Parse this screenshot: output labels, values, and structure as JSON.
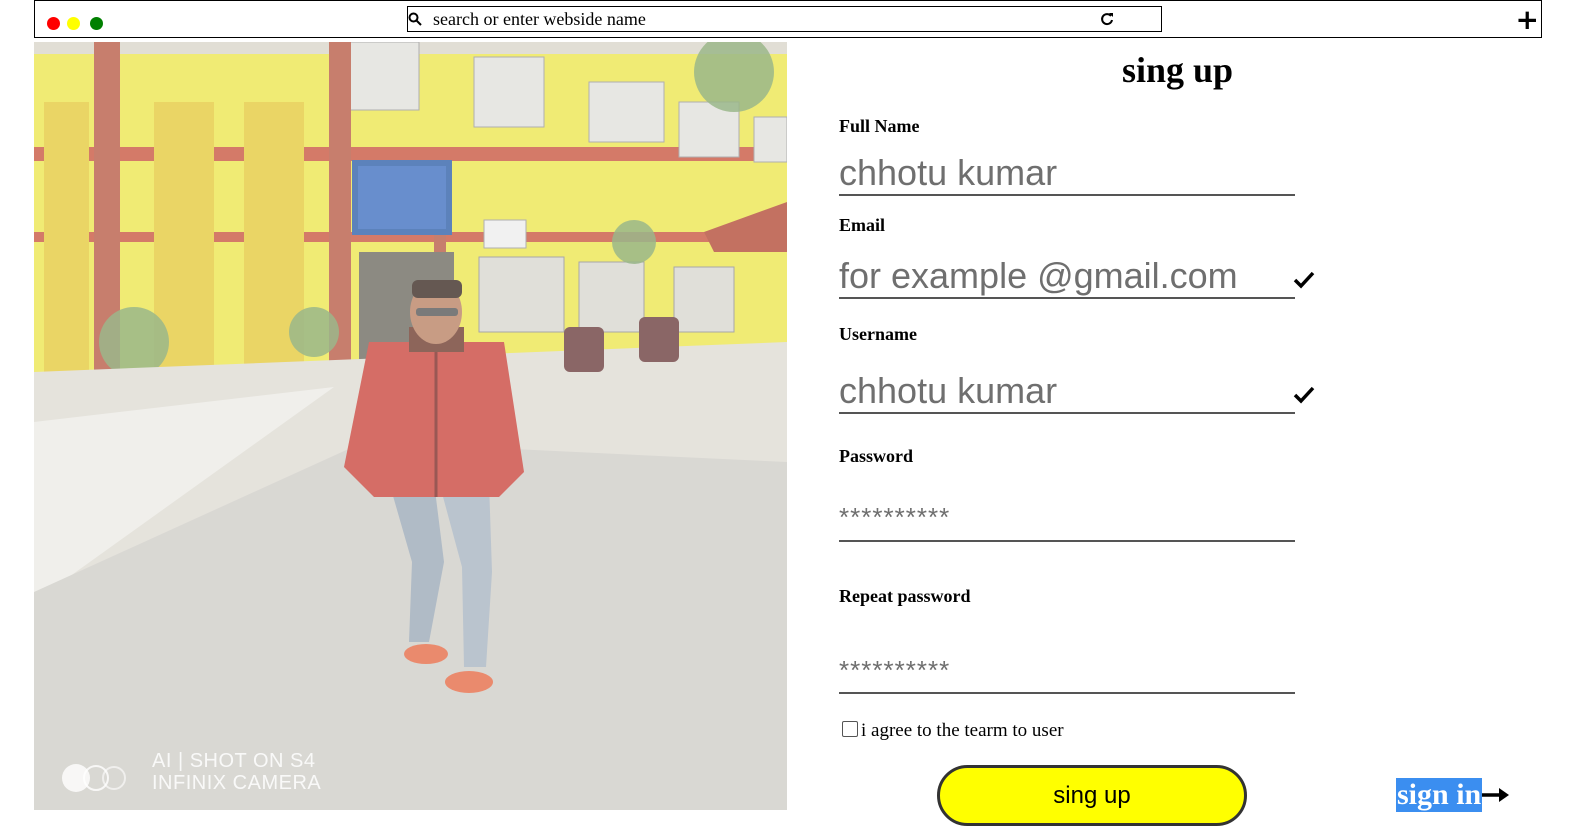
{
  "browser": {
    "search_placeholder": "search or enter webside name",
    "icons": {
      "traffic_lights": [
        "red-dot",
        "yellow-dot",
        "green-dot"
      ],
      "search": "search-icon",
      "reload": "reload-icon",
      "new_tab": "plus-icon"
    }
  },
  "photo": {
    "watermark_line1": "AI | SHOT ON S4",
    "watermark_line2": "INFINIX CAMERA"
  },
  "form": {
    "title": "sing up",
    "full_name": {
      "label": "Full Name",
      "value": "chhotu kumar"
    },
    "email": {
      "label": "Email",
      "value": "for example @gmail.com"
    },
    "username": {
      "label": "Username",
      "value": "chhotu kumar"
    },
    "password": {
      "label": "Password",
      "value": "**********"
    },
    "repeat_password": {
      "label": "Repeat password",
      "value": "**********"
    },
    "agree_text": "i agree to the tearm to user",
    "agree_checked": false,
    "submit_label": "sing up",
    "signin_label": "sign in"
  },
  "colors": {
    "submit_bg": "#ffff00",
    "signin_bg": "#3b8ef0",
    "dot_red": "#ff0000",
    "dot_yellow": "#ffff00",
    "dot_green": "#008000"
  }
}
